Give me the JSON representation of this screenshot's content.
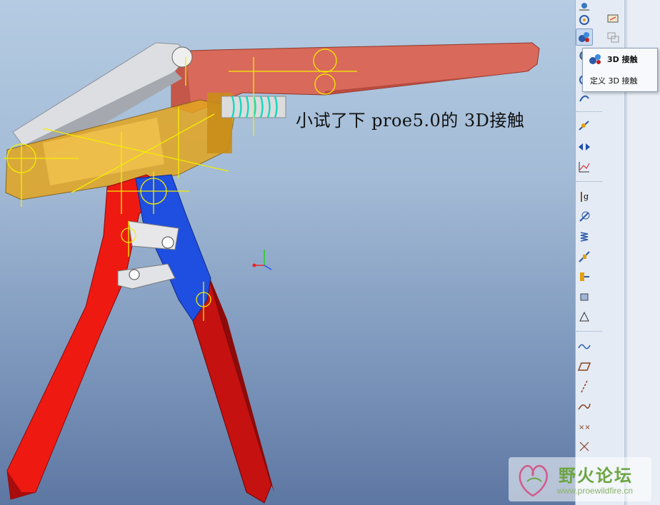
{
  "caption": "小试了下  proe5.0的 3D接触",
  "popup": {
    "item_main": "3D 接触",
    "item_define": "定义 3D 接触"
  },
  "toolbar": {
    "buttons": [
      {
        "name": "view-icon"
      },
      {
        "name": "drag-components-icon"
      },
      {
        "name": "servo-motor-icon"
      },
      {
        "name": "3d-contact-icon",
        "active": true
      },
      {
        "name": "connection-icon"
      },
      {
        "name": "cam-icon"
      },
      {
        "name": "gear-pair-icon"
      },
      {
        "name": "belt-icon"
      },
      {
        "name": "mechanism-analysis-icon"
      },
      {
        "name": "playback-icon"
      },
      {
        "name": "measure-icon"
      },
      {
        "name": "gravity-icon"
      },
      {
        "name": "force-motor-icon"
      },
      {
        "name": "spring-icon"
      },
      {
        "name": "damper-icon"
      },
      {
        "name": "bushing-load-icon"
      },
      {
        "name": "mass-properties-icon"
      },
      {
        "name": "initial-condition-icon"
      },
      {
        "name": "curve-icon"
      },
      {
        "name": "plane-icon"
      },
      {
        "name": "axis-icon"
      },
      {
        "name": "sketch-curve-icon"
      },
      {
        "name": "point-icon"
      },
      {
        "name": "coordinate-system-icon"
      }
    ]
  },
  "watermark": {
    "title": "野火论坛",
    "url": "www.proewildfire.cn"
  },
  "colors": {
    "handle_salmon": "#d9695a",
    "arm_red": "#ee1a12",
    "arm_dark_red": "#a80c0c",
    "link_blue": "#1f4fe0",
    "body_yellow": "#e3a520",
    "lever_grey": "#d3d5da",
    "constraint_yellow": "#f3ee00",
    "spring_cyan": "#19d7c2"
  }
}
